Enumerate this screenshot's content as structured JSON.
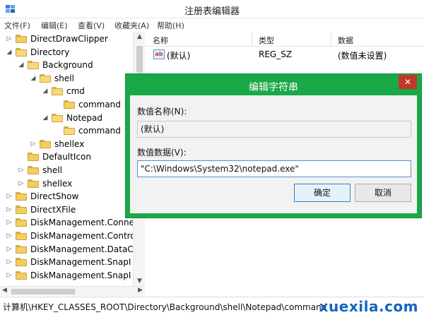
{
  "window": {
    "title": "注册表编辑器"
  },
  "menu": [
    "文件(F)",
    "编辑(E)",
    "查看(V)",
    "收藏夹(A)",
    "帮助(H)"
  ],
  "tree": [
    {
      "label": "DirectDrawClipper",
      "level": 1,
      "expander": "collapsed",
      "open": false
    },
    {
      "label": "Directory",
      "level": 1,
      "expander": "expanded",
      "open": true
    },
    {
      "label": "Background",
      "level": 2,
      "expander": "expanded",
      "open": true
    },
    {
      "label": "shell",
      "level": 3,
      "expander": "expanded",
      "open": true
    },
    {
      "label": "cmd",
      "level": 4,
      "expander": "expanded",
      "open": true
    },
    {
      "label": "command",
      "level": 5,
      "expander": "none",
      "open": false
    },
    {
      "label": "Notepad",
      "level": 4,
      "expander": "expanded",
      "open": true
    },
    {
      "label": "command",
      "level": 5,
      "expander": "none",
      "open": true
    },
    {
      "label": "shellex",
      "level": 3,
      "expander": "collapsed",
      "open": false
    },
    {
      "label": "DefaultIcon",
      "level": 2,
      "expander": "none",
      "open": false
    },
    {
      "label": "shell",
      "level": 2,
      "expander": "collapsed",
      "open": false
    },
    {
      "label": "shellex",
      "level": 2,
      "expander": "collapsed",
      "open": false
    },
    {
      "label": "DirectShow",
      "level": 1,
      "expander": "collapsed",
      "open": false
    },
    {
      "label": "DirectXFile",
      "level": 1,
      "expander": "collapsed",
      "open": false
    },
    {
      "label": "DiskManagement.Conne",
      "level": 1,
      "expander": "collapsed",
      "open": false
    },
    {
      "label": "DiskManagement.Contro",
      "level": 1,
      "expander": "collapsed",
      "open": false
    },
    {
      "label": "DiskManagement.DataC",
      "level": 1,
      "expander": "collapsed",
      "open": false
    },
    {
      "label": "DiskManagement.SnapI",
      "level": 1,
      "expander": "collapsed",
      "open": false
    },
    {
      "label": "DiskManagement.SnapI",
      "level": 1,
      "expander": "collapsed",
      "open": false
    }
  ],
  "list": {
    "headers": {
      "name": "名称",
      "type": "类型",
      "data": "数据"
    },
    "rows": [
      {
        "icon": "string-value-icon",
        "icon_text": "ab",
        "name": "(默认)",
        "type": "REG_SZ",
        "data": "(数值未设置)"
      }
    ]
  },
  "dialog": {
    "title": "编辑字符串",
    "name_label": "数值名称(N):",
    "name_value": "(默认)",
    "data_label": "数值数据(V):",
    "data_value": "\"C:\\Windows\\System32\\notepad.exe\"",
    "ok": "确定",
    "cancel": "取消",
    "close_glyph": "✕",
    "border_color": "#1aa848"
  },
  "status": {
    "path": "计算机\\HKEY_CLASSES_ROOT\\Directory\\Background\\shell\\Notepad\\command"
  },
  "watermark": "xuexila.com"
}
